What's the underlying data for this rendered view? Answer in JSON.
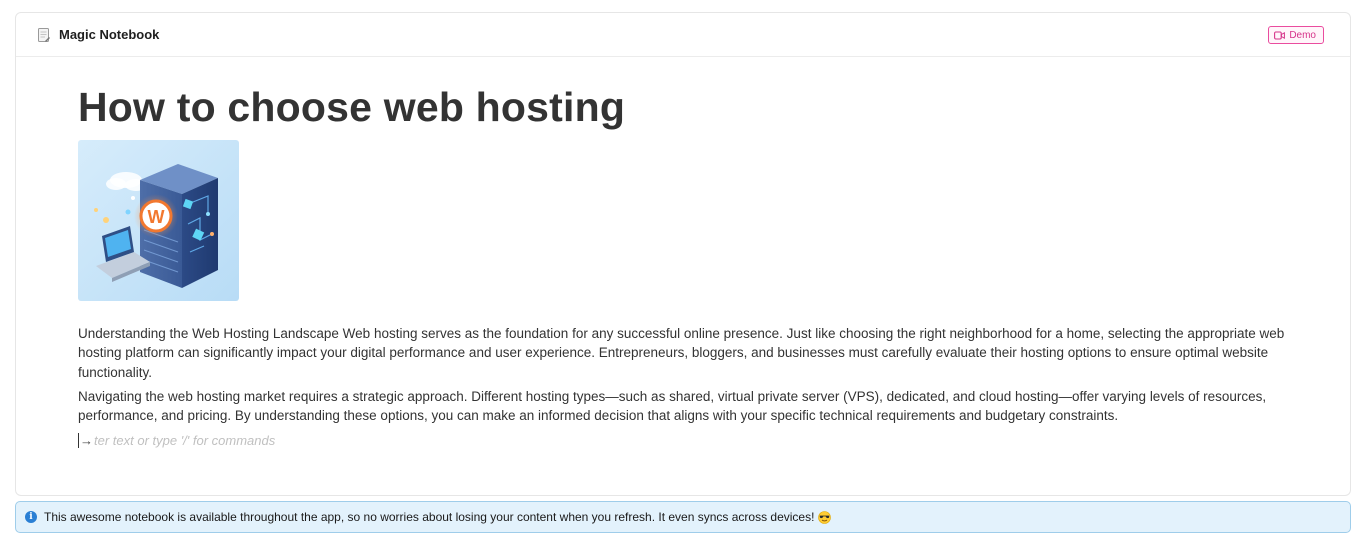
{
  "header": {
    "icon": "notebook-icon",
    "title": "Magic Notebook",
    "badge_icon": "video-icon",
    "badge_label": "Demo"
  },
  "document": {
    "title": "How to choose web hosting",
    "image_alt": "server-illustration",
    "paragraphs": [
      "Understanding the Web Hosting Landscape Web hosting serves as the foundation for any successful online presence. Just like choosing the right neighborhood for a home, selecting the appropriate web hosting platform can significantly impact your digital performance and user experience. Entrepreneurs, bloggers, and businesses must carefully evaluate their hosting options to ensure optimal website functionality.",
      "Navigating the web hosting market requires a strategic approach. Different hosting types—such as shared, virtual private server (VPS), dedicated, and cloud hosting—offer varying levels of resources, performance, and pricing. By understanding these options, you can make an informed decision that aligns with your specific technical requirements and budgetary constraints."
    ],
    "input_arrow": "→",
    "input_placeholder": "ter text or type '/' for commands"
  },
  "info_bar": {
    "icon": "info-icon",
    "text": "This awesome notebook is available throughout the app, so no worries about losing your content when you refresh. It even syncs across devices!",
    "emoji": "sunglasses-emoji"
  },
  "colors": {
    "badge": "#ea4c9f",
    "info_border": "#9fcdea",
    "info_bg": "#e3f2fc",
    "info_icon": "#2a7fd4"
  }
}
